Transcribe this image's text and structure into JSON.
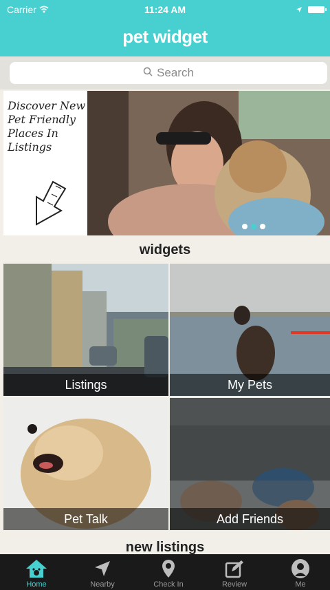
{
  "status": {
    "carrier": "Carrier",
    "time": "11:24 AM"
  },
  "header": {
    "title": "pet widget"
  },
  "search": {
    "placeholder": "Search"
  },
  "banner": {
    "text": "Discover New Pet Friendly Places In Listings",
    "page_count": 3,
    "active_page": 2
  },
  "sections": {
    "widgets": "widgets",
    "new_listings": "new listings"
  },
  "widgets": [
    {
      "label": "Listings"
    },
    {
      "label": "My Pets"
    },
    {
      "label": "Pet Talk"
    },
    {
      "label": "Add Friends"
    }
  ],
  "tabs": [
    {
      "label": "Home",
      "icon": "home-icon",
      "active": true
    },
    {
      "label": "Nearby",
      "icon": "location-arrow-icon",
      "active": false
    },
    {
      "label": "Check In",
      "icon": "map-pin-icon",
      "active": false
    },
    {
      "label": "Review",
      "icon": "edit-icon",
      "active": false
    },
    {
      "label": "Me",
      "icon": "profile-icon",
      "active": false
    }
  ],
  "colors": {
    "accent": "#48d0d0",
    "tabbar": "#1a1a1a",
    "background": "#f2efe9"
  }
}
